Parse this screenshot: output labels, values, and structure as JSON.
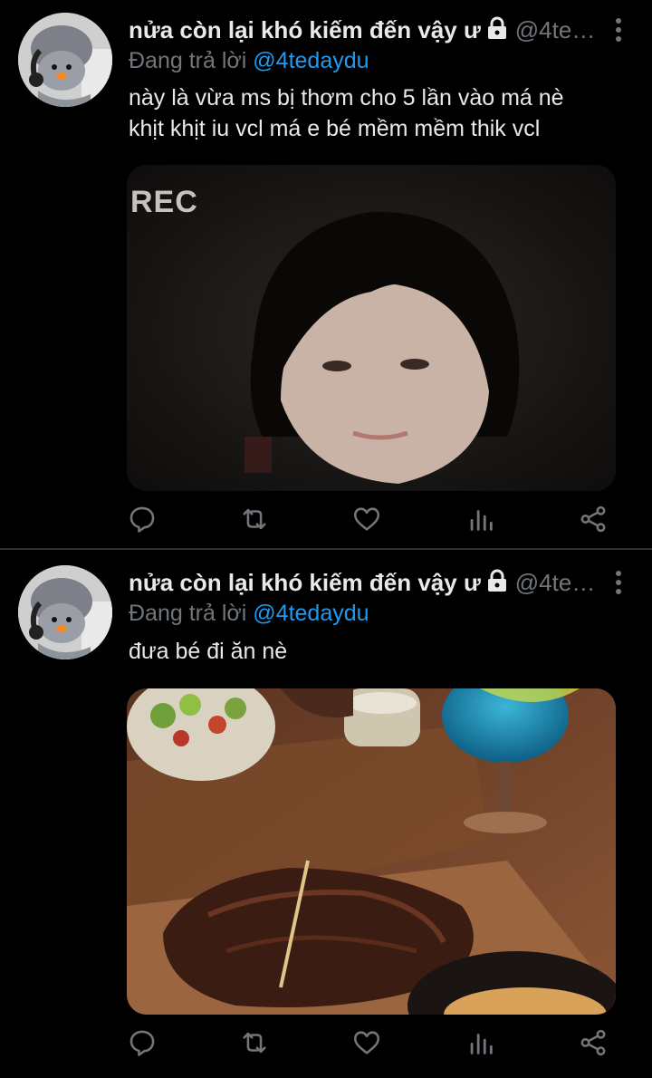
{
  "tweets": [
    {
      "display_name": "nửa còn lại khó kiếm đến vậy ư",
      "handle": "@4te…",
      "reply_prefix": "Đang trả lời",
      "reply_to": "@4tedaydu",
      "text_line1": "này là vừa ms bị thơm cho 5 lần vào má nè",
      "text_line2": "khịt khịt iu vcl má e bé mềm mềm thik vcl",
      "media_label": "REC"
    },
    {
      "display_name": "nửa còn lại khó kiếm đến vậy ư",
      "handle": "@4te…",
      "reply_prefix": "Đang trả lời",
      "reply_to": "@4tedaydu",
      "text_line1": "đưa bé đi ăn nè"
    }
  ],
  "icons": {
    "lock": "lock-icon",
    "more": "more-vertical-icon",
    "reply": "reply-icon",
    "retweet": "retweet-icon",
    "like": "heart-icon",
    "views": "analytics-icon",
    "share": "share-icon"
  },
  "colors": {
    "background": "#000000",
    "text": "#e7e9ea",
    "secondary": "#71767b",
    "link": "#1d9bf0",
    "divider": "#2f3336"
  }
}
